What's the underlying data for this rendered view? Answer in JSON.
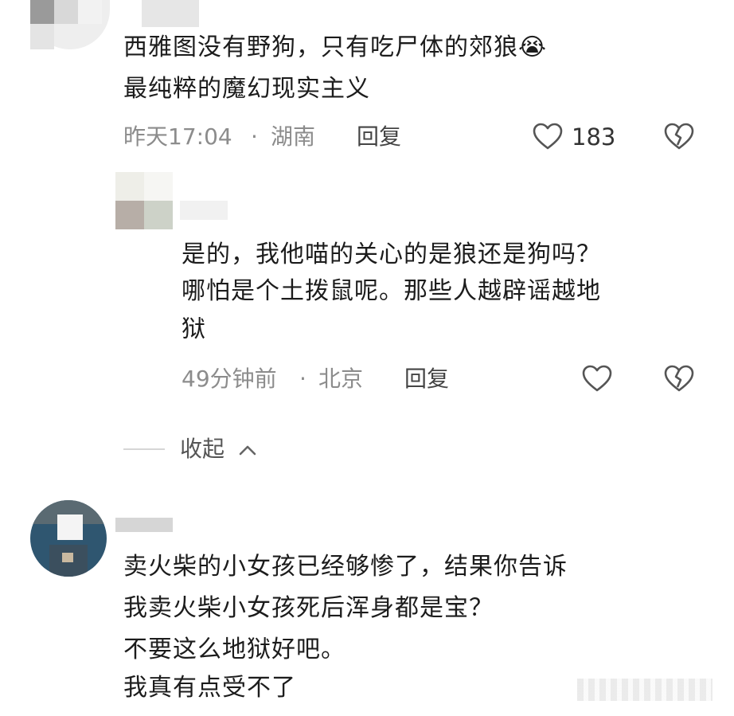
{
  "comments": [
    {
      "lines": [
        "西雅图没有野狗，只有吃尸体的郊狼😭",
        "最纯粹的魔幻现实主义"
      ],
      "time": "昨天17:04",
      "location": "湖南",
      "reply_label": "回复",
      "like_count": "183"
    }
  ],
  "reply": {
    "lines": [
      "是的，我他喵的关心的是狼还是狗吗？",
      "哪怕是个土拨鼠呢。那些人越辟谣越地",
      "狱"
    ],
    "time": "49分钟前",
    "location": "北京",
    "reply_label": "回复"
  },
  "collapse": {
    "label": "收起"
  },
  "third_comment": {
    "lines": [
      "卖火柴的小女孩已经够惨了，结果你告诉",
      "我卖火柴小女孩死后浑身都是宝？",
      "不要这么地狱好吧。",
      "我真有点受不了"
    ]
  },
  "separator": "·",
  "colors": {
    "meta": "#8c8c8c",
    "text": "#1c1c1c",
    "icon": "#555555"
  },
  "icons": [
    "like-heart-icon",
    "dislike-broken-heart-icon",
    "chevron-up-icon"
  ]
}
